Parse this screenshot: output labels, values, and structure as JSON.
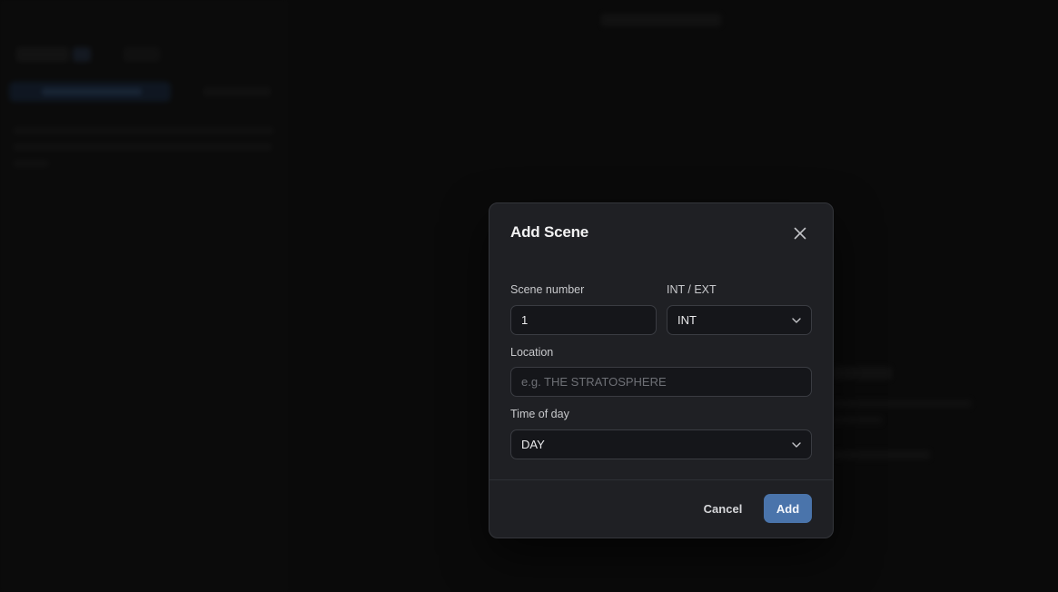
{
  "dialog": {
    "title": "Add Scene",
    "close_icon": "close-icon",
    "fields": {
      "scene_number": {
        "label": "Scene number",
        "value": "1"
      },
      "int_ext": {
        "label": "INT / EXT",
        "value": "INT",
        "icon": "chevron-down-icon"
      },
      "location": {
        "label": "Location",
        "value": "",
        "placeholder": "e.g. THE STRATOSPHERE"
      },
      "time_of_day": {
        "label": "Time of day",
        "value": "DAY",
        "icon": "chevron-down-icon"
      }
    },
    "buttons": {
      "cancel": "Cancel",
      "add": "Add"
    }
  },
  "colors": {
    "background": "#101010",
    "dialog_bg": "#1f2024",
    "input_bg": "#15161a",
    "accent": "#4a74ab"
  }
}
